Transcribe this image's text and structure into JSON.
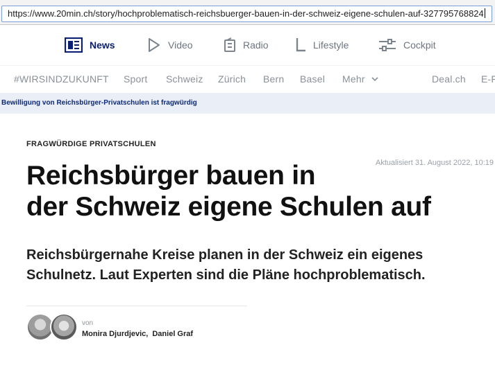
{
  "browser": {
    "url": "https://www.20min.ch/story/hochproblematisch-reichsbuerger-bauen-in-der-schweiz-eigene-schulen-auf-327795768824"
  },
  "topnav": {
    "items": [
      {
        "label": "News",
        "icon": "newspaper-icon",
        "active": true
      },
      {
        "label": "Video",
        "icon": "play-icon",
        "active": false
      },
      {
        "label": "Radio",
        "icon": "radio-icon",
        "active": false
      },
      {
        "label": "Lifestyle",
        "icon": "lifestyle-icon",
        "active": false
      },
      {
        "label": "Cockpit",
        "icon": "sliders-icon",
        "active": false
      }
    ]
  },
  "sections": [
    "#WIRSINDZUKUNFT",
    "Sport",
    "Schweiz",
    "Zürich",
    "Bern",
    "Basel",
    "Mehr",
    "Deal.ch",
    "E-F"
  ],
  "banner": {
    "text": "Bewilligung von Reichsbürger-Privatschulen ist fragwürdig"
  },
  "article": {
    "kicker": "FRAGWÜRDIGE PRIVATSCHULEN",
    "updated": "Aktualisiert 31. August 2022, 10:19",
    "headline_line1": "Reichsbürger bauen in",
    "headline_line2": "der Schweiz eigene Schulen auf",
    "lead_line1": "Reichsbürgernahe Kreise planen in der Schweiz ein eigenes",
    "lead_line2": "Schulnetz. Laut Experten sind die Pläne hochproblematisch.",
    "byline_prefix": "von",
    "author1": "Monira Djurdjevic",
    "author_sep": ",",
    "author2": "Daniel Graf"
  },
  "colors": {
    "brand": "#0b1f72",
    "banner_bg": "#e9eef7",
    "nav_text": "#6c7580"
  }
}
